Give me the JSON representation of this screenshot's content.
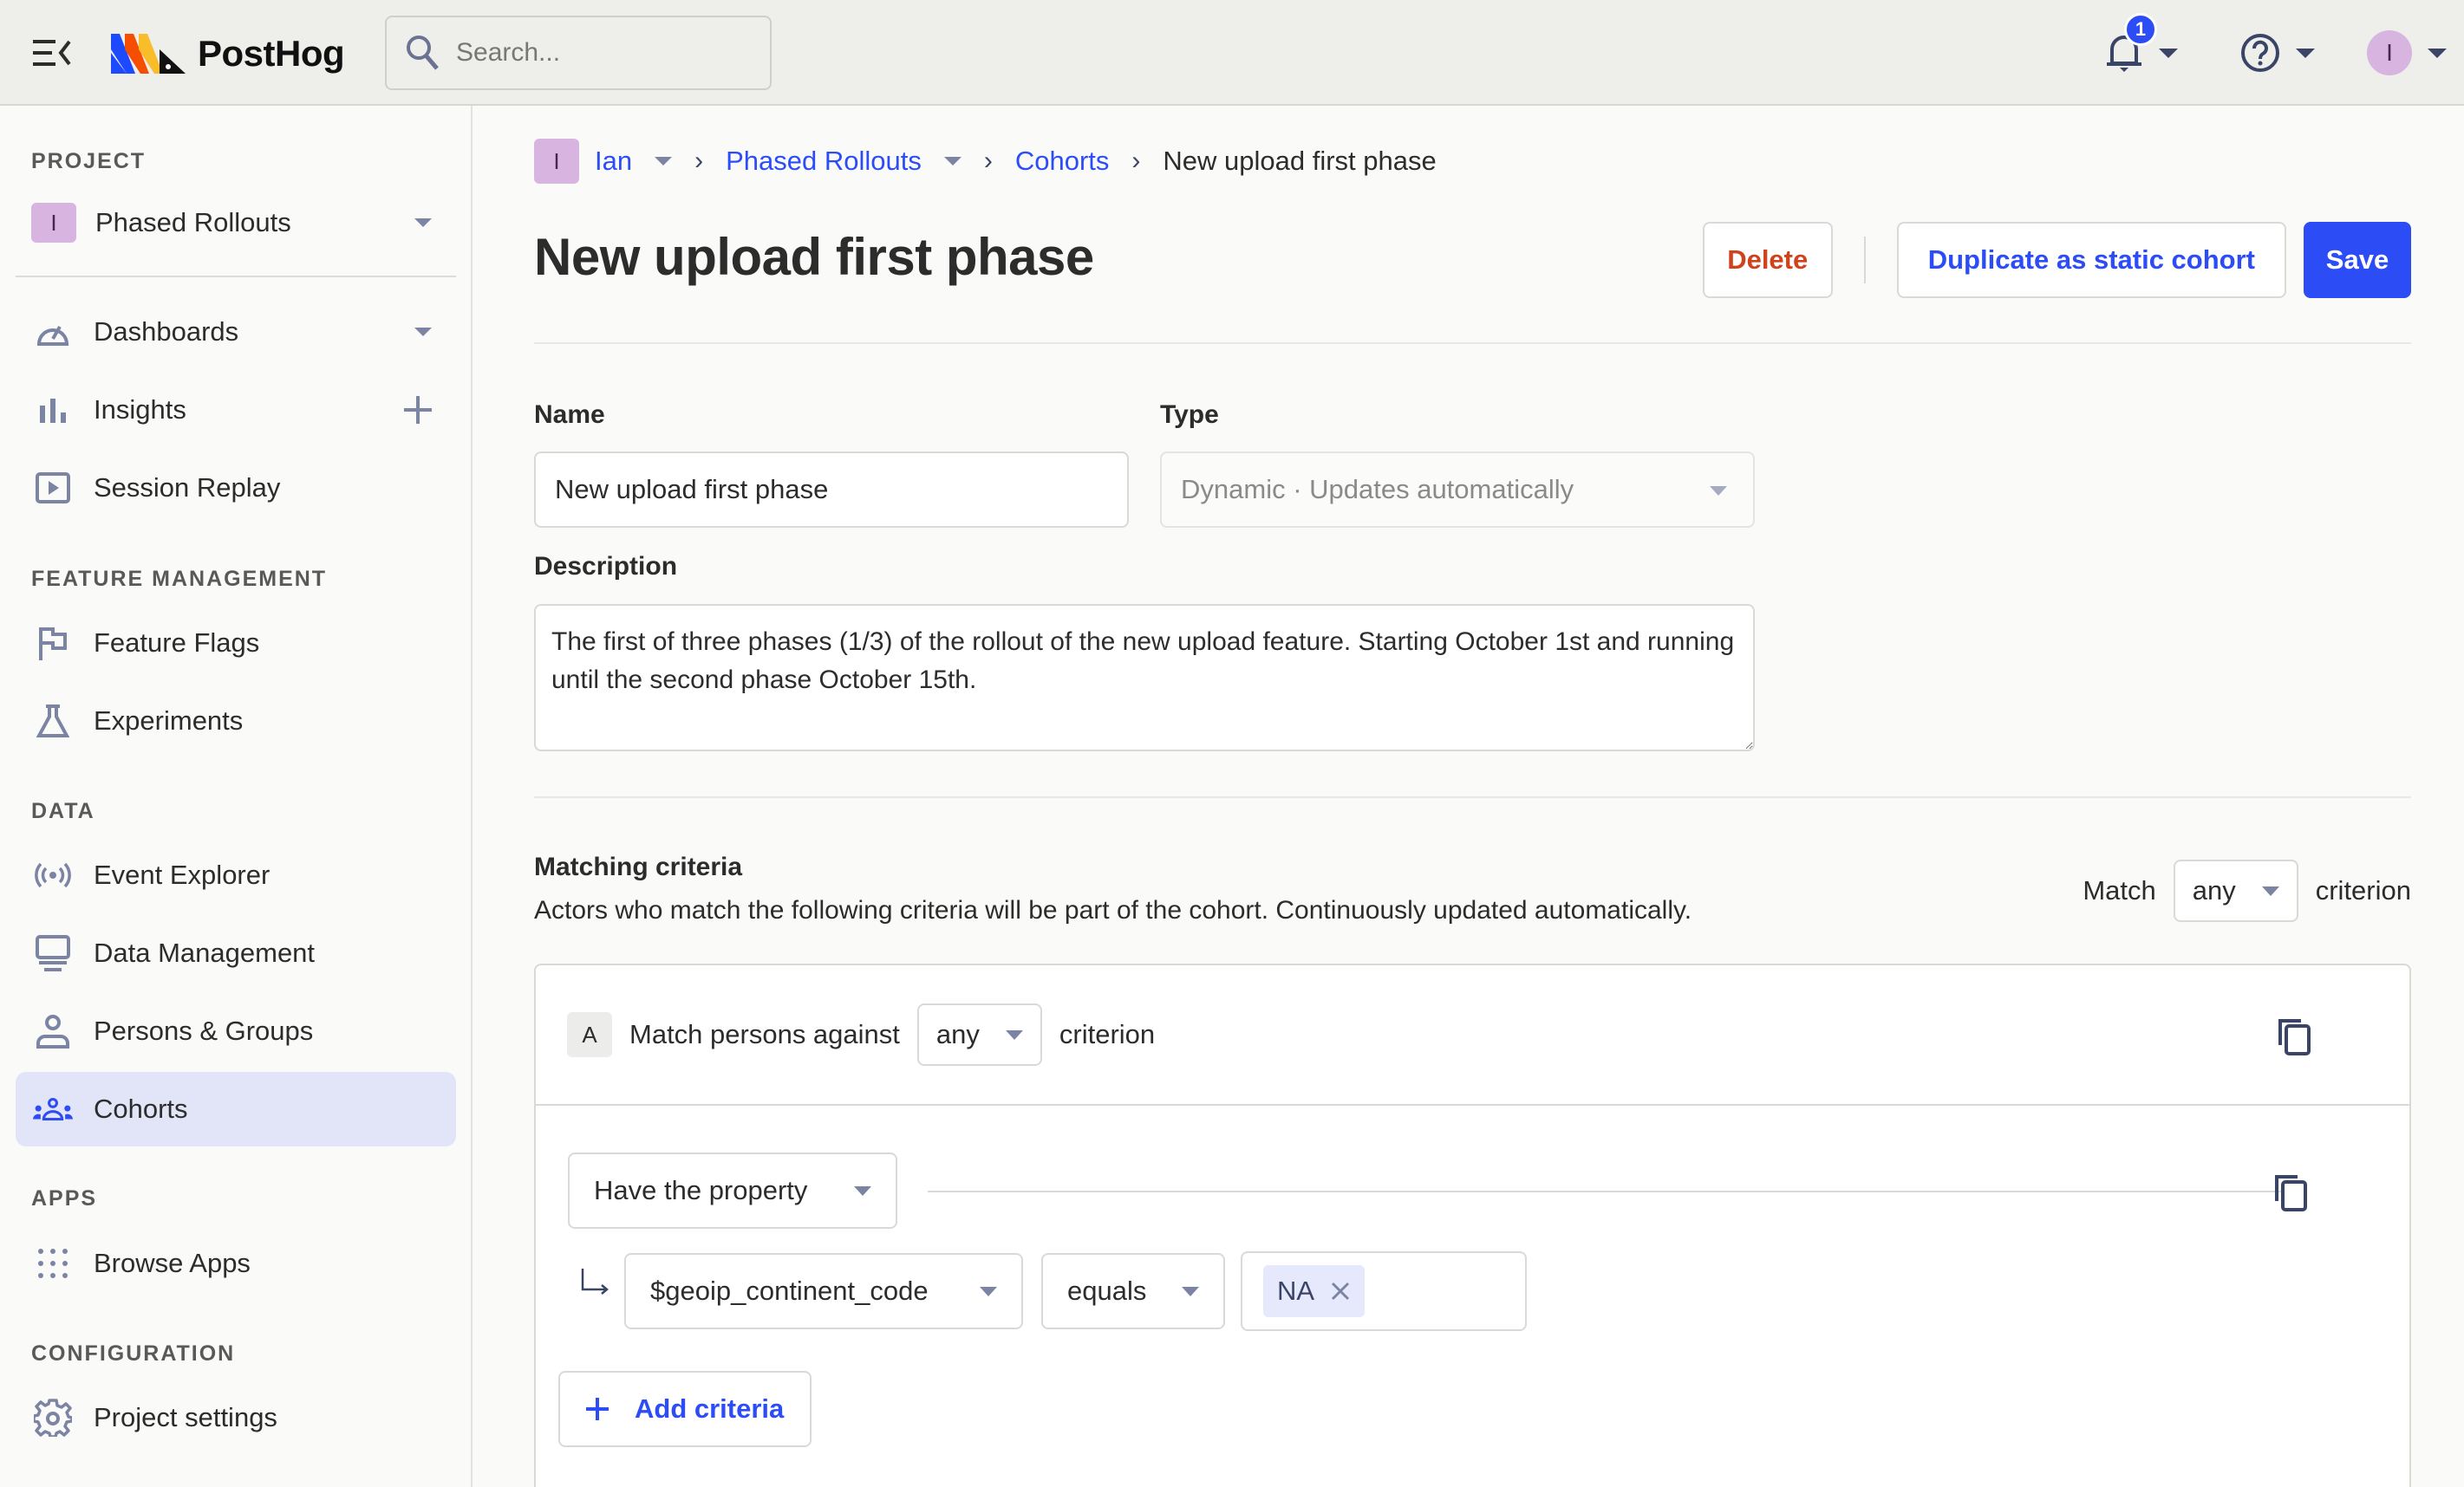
{
  "topbar": {
    "brand": "PostHog",
    "search_placeholder": "Search...",
    "notification_count": "1",
    "avatar_initial": "I"
  },
  "sidebar": {
    "sections": [
      {
        "title": "PROJECT"
      },
      {
        "title": "FEATURE MANAGEMENT"
      },
      {
        "title": "DATA"
      },
      {
        "title": "APPS"
      },
      {
        "title": "CONFIGURATION"
      }
    ],
    "project": {
      "initial": "I",
      "name": "Phased Rollouts"
    },
    "items": [
      {
        "label": "Dashboards",
        "icon": "gauge-icon"
      },
      {
        "label": "Insights",
        "icon": "bar-chart-icon"
      },
      {
        "label": "Session Replay",
        "icon": "play-square-icon"
      },
      {
        "label": "Feature Flags",
        "icon": "flag-icon"
      },
      {
        "label": "Experiments",
        "icon": "flask-icon"
      },
      {
        "label": "Event Explorer",
        "icon": "broadcast-icon"
      },
      {
        "label": "Data Management",
        "icon": "monitor-icon"
      },
      {
        "label": "Persons & Groups",
        "icon": "person-icon"
      },
      {
        "label": "Cohorts",
        "icon": "people-icon",
        "active": true
      },
      {
        "label": "Browse Apps",
        "icon": "grid-dots-icon"
      },
      {
        "label": "Project settings",
        "icon": "gear-icon"
      }
    ]
  },
  "breadcrumb": {
    "org_initial": "I",
    "org": "Ian",
    "project": "Phased Rollouts",
    "section": "Cohorts",
    "current": "New upload first phase"
  },
  "page": {
    "title": "New upload first phase",
    "actions": {
      "delete": "Delete",
      "duplicate": "Duplicate as static cohort",
      "save": "Save"
    }
  },
  "form": {
    "name_label": "Name",
    "name_value": "New upload first phase",
    "type_label": "Type",
    "type_value": "Dynamic · Updates automatically",
    "description_label": "Description",
    "description_value": "The first of three phases (1/3) of the rollout of the new upload feature. Starting October 1st and running until the second phase October 15th."
  },
  "matching": {
    "title": "Matching criteria",
    "description": "Actors who match the following criteria will be part of the cohort. Continuously updated automatically.",
    "match_prefix": "Match",
    "match_value": "any",
    "match_suffix": "criterion",
    "groups": [
      {
        "letter": "A",
        "prefix": "Match persons against",
        "match_value": "any",
        "suffix": "criterion",
        "criteria": [
          {
            "type": "Have the property",
            "property": "$geoip_continent_code",
            "operator": "equals",
            "values": [
              "NA"
            ]
          }
        ],
        "add_label": "Add criteria"
      }
    ]
  },
  "colors": {
    "accent": "#2c4cf5",
    "danger": "#d0421b",
    "avatar": "#d8b4e0",
    "active_nav": "#e2e5f8"
  }
}
